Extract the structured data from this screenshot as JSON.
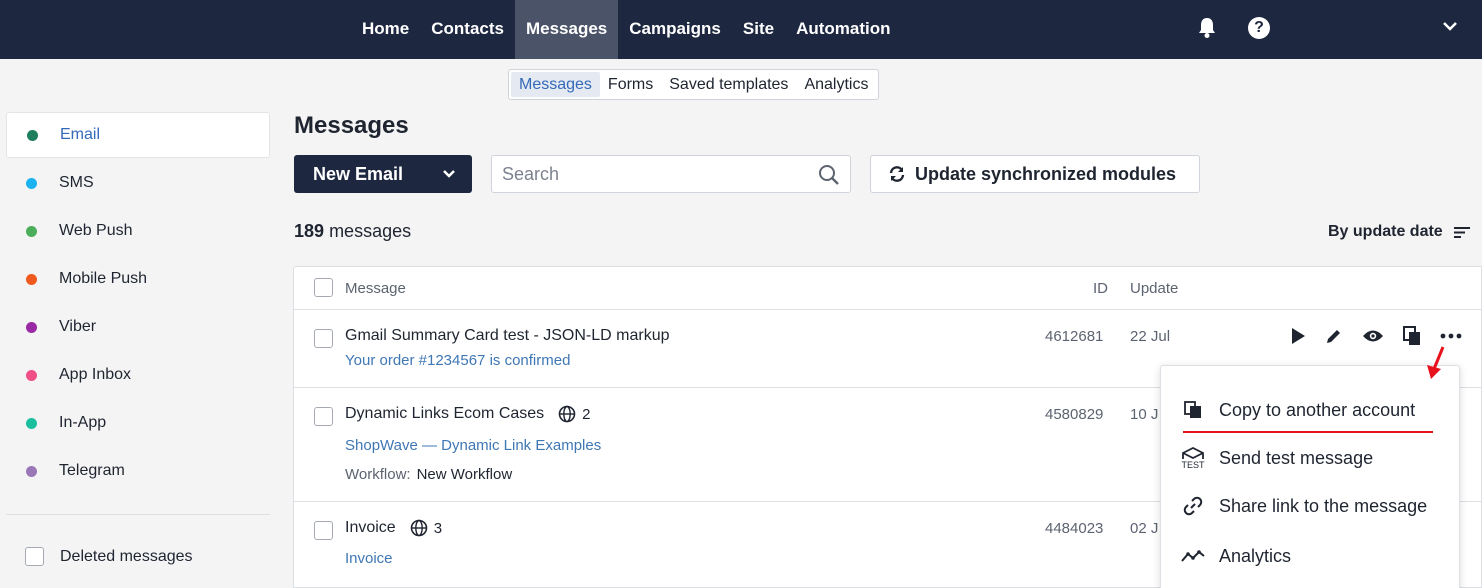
{
  "topnav": {
    "items": [
      "Home",
      "Contacts",
      "Messages",
      "Campaigns",
      "Site",
      "Automation"
    ],
    "active": "Messages"
  },
  "subtabs": [
    "Messages",
    "Forms",
    "Saved templates",
    "Analytics"
  ],
  "sidebar": {
    "items": [
      {
        "label": "Email",
        "color": "#1f7f5c"
      },
      {
        "label": "SMS",
        "color": "#1ab2ef"
      },
      {
        "label": "Web Push",
        "color": "#4cae5a"
      },
      {
        "label": "Mobile Push",
        "color": "#ee5a1e"
      },
      {
        "label": "Viber",
        "color": "#9a2aa3"
      },
      {
        "label": "App Inbox",
        "color": "#ef4f86"
      },
      {
        "label": "In-App",
        "color": "#1bbf9e"
      },
      {
        "label": "Telegram",
        "color": "#9a78b7"
      }
    ],
    "deleted_label": "Deleted messages"
  },
  "main": {
    "title": "Messages",
    "new_button": "New Email",
    "search_placeholder": "Search",
    "sync_button": "Update synchronized modules",
    "count_number": "189",
    "count_label": "messages",
    "sort_label": "By update date"
  },
  "table": {
    "headers": {
      "message": "Message",
      "id": "ID",
      "update": "Update"
    },
    "rows": [
      {
        "title": "Gmail Summary Card test - JSON-LD markup",
        "subtitle": "Your order #1234567 is confirmed",
        "id": "4612681",
        "date": "22 Jul"
      },
      {
        "title": "Dynamic Links Ecom Cases",
        "langs": "2",
        "subtitle": "ShopWave — Dynamic Link Examples",
        "workflow_label": "Workflow:",
        "workflow_value": "New Workflow",
        "id": "4580829",
        "date": "10 J"
      },
      {
        "title": "Invoice",
        "langs": "3",
        "subtitle": "Invoice",
        "id": "4484023",
        "date": "02 J"
      }
    ]
  },
  "menu": {
    "items": [
      "Copy to another account",
      "Send test message",
      "Share link to the message",
      "Analytics"
    ],
    "test_badge": "TEST"
  }
}
